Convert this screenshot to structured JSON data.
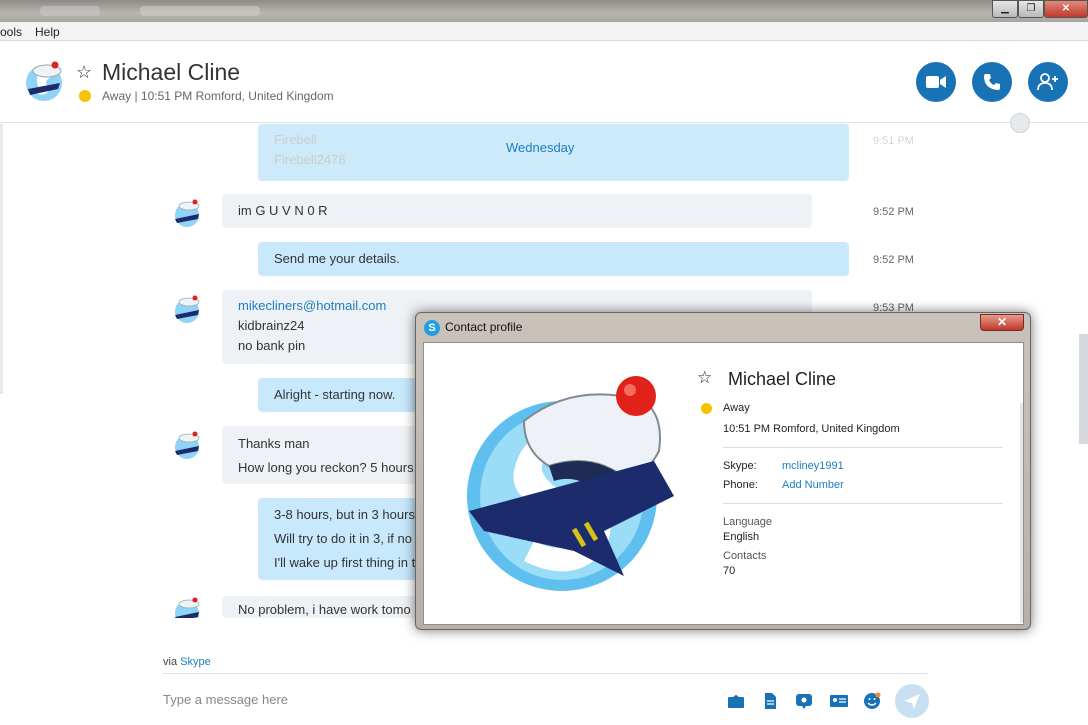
{
  "menu": {
    "tools": "ools",
    "help": "Help"
  },
  "window": {
    "minimize": "▁",
    "restore": "❐",
    "close": "✕"
  },
  "header": {
    "name": "Michael Cline",
    "status": "Away  |  10:51 PM Romford, United Kingdom"
  },
  "chat": {
    "day": "Wednesday",
    "faded_lines": [
      "Firebell",
      "Firebell2478"
    ],
    "faded_time": "9:51 PM",
    "messages": [
      {
        "lines": [
          "im G U V N 0 R"
        ],
        "time": "9:52 PM"
      },
      {
        "lines": [
          "Send me your details."
        ],
        "time": "9:52 PM"
      },
      {
        "link": "mikecliners@hotmail.com",
        "lines": [
          "kidbrainz24",
          "no bank pin"
        ],
        "time": "9:53 PM"
      },
      {
        "lines": [
          "Alright - starting now."
        ]
      },
      {
        "lines": [
          "Thanks man",
          "How long you reckon? 5 hours"
        ]
      },
      {
        "lines": [
          "3-8 hours, but in 3 hours",
          "Will try to do it in 3, if no",
          "I'll wake up first thing in t"
        ]
      },
      {
        "lines": [
          "No problem, i have work tomo"
        ]
      }
    ]
  },
  "footer": {
    "via": "via",
    "via_app": "Skype",
    "placeholder": "Type a message here"
  },
  "dialog": {
    "title": "Contact profile",
    "close": "✕",
    "name": "Michael Cline",
    "status": "Away",
    "local_time": "10:51 PM Romford, United Kingdom",
    "skype_label": "Skype:",
    "skype_value": "mcliney1991",
    "phone_label": "Phone:",
    "phone_value": "Add Number",
    "language_label": "Language",
    "language_value": "English",
    "contacts_label": "Contacts",
    "contacts_value": "70"
  },
  "colors": {
    "accent": "#1772b6",
    "outgoing": "#c8e8fb",
    "incoming": "#eef1f5",
    "away": "#f5c300"
  }
}
